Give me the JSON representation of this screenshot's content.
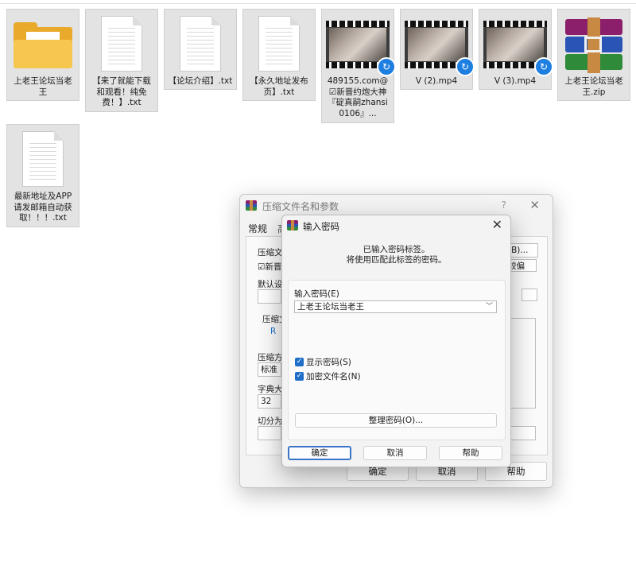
{
  "files": [
    {
      "name": "上老王论坛当老王",
      "type": "folder"
    },
    {
      "name": "【来了就能下载和观看！纯免费！】.txt",
      "type": "text"
    },
    {
      "name": "【论坛介绍】.txt",
      "type": "text"
    },
    {
      "name": "【永久地址发布页】.txt",
      "type": "text"
    },
    {
      "name": "489155.com@☑新晋约炮大神『碇真嗣zhansi0106』...",
      "type": "video"
    },
    {
      "name": "V (2).mp4",
      "type": "video"
    },
    {
      "name": "V (3).mp4",
      "type": "video"
    },
    {
      "name": "上老王论坛当老王.zip",
      "type": "archive"
    },
    {
      "name": "最新地址及APP请发邮箱自动获取！！！.txt",
      "type": "text"
    }
  ],
  "archive_dialog": {
    "title": "压缩文件名和参数",
    "help_glyph": "?",
    "close_glyph": "✕",
    "tab_general": "常规",
    "tab_second": "高",
    "label_archive_name": "压缩文件",
    "label_update_mode": "☑新晋",
    "browse_button": "(B)...",
    "label_default_settings": "默认设置",
    "update_mode_value": "较偏",
    "label_format": "压缩文",
    "format_option": "R",
    "label_method": "压缩方",
    "method_value": "标准",
    "label_dict": "字典大小",
    "dict_value": "32",
    "label_split": "切分为分",
    "ok": "确定",
    "cancel": "取消",
    "help": "帮助"
  },
  "password_dialog": {
    "title": "输入密码",
    "close_glyph": "✕",
    "info_line1": "已输入密码标签。",
    "info_line2": "将使用匹配此标签的密码。",
    "password_label": "输入密码(E)",
    "password_value": "上老王论坛当老王",
    "show_password": "显示密码(S)",
    "encrypt_filenames": "加密文件名(N)",
    "organize_button": "整理密码(O)...",
    "ok": "确定",
    "cancel": "取消",
    "help": "帮助"
  }
}
